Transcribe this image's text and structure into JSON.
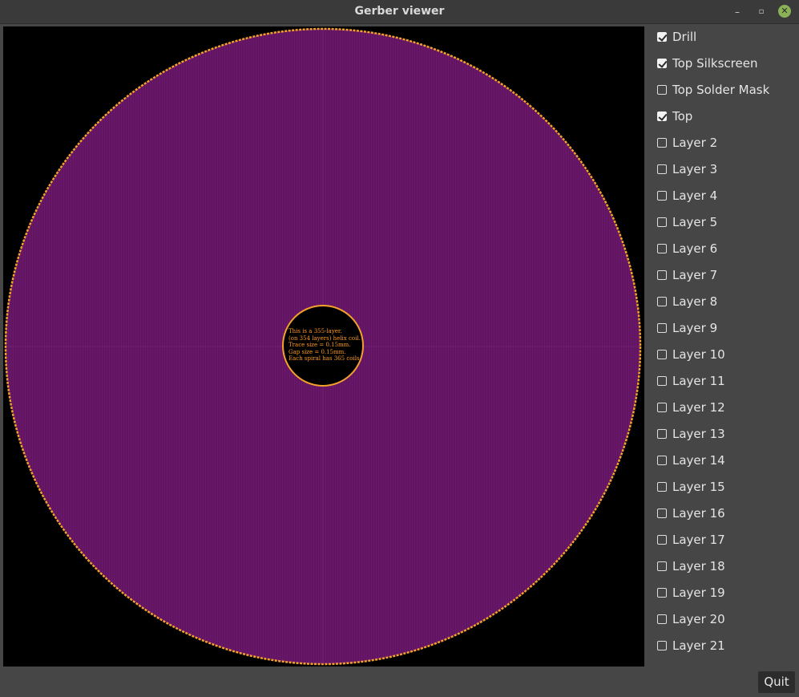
{
  "window": {
    "title": "Gerber viewer",
    "controls": {
      "minimize": "–",
      "maximize": "▫",
      "close": "✕"
    }
  },
  "board": {
    "text_lines": [
      "This is a 355-layer.",
      "(on 354 layers) helix coil.",
      "Trace size = 0.15mm.",
      "Gap size = 0.15mm.",
      "Each spiral has 365 coils."
    ],
    "colors": {
      "board_fill": "#621463",
      "outline": "#f4a12a",
      "silkscreen_text": "#ff9a1f",
      "background": "#000000"
    }
  },
  "layers": [
    {
      "label": "Drill",
      "checked": true
    },
    {
      "label": "Top Silkscreen",
      "checked": true
    },
    {
      "label": "Top Solder Mask",
      "checked": false
    },
    {
      "label": "Top",
      "checked": true
    },
    {
      "label": "Layer 2",
      "checked": false
    },
    {
      "label": "Layer 3",
      "checked": false
    },
    {
      "label": "Layer 4",
      "checked": false
    },
    {
      "label": "Layer 5",
      "checked": false
    },
    {
      "label": "Layer 6",
      "checked": false
    },
    {
      "label": "Layer 7",
      "checked": false
    },
    {
      "label": "Layer 8",
      "checked": false
    },
    {
      "label": "Layer 9",
      "checked": false
    },
    {
      "label": "Layer 10",
      "checked": false
    },
    {
      "label": "Layer 11",
      "checked": false
    },
    {
      "label": "Layer 12",
      "checked": false
    },
    {
      "label": "Layer 13",
      "checked": false
    },
    {
      "label": "Layer 14",
      "checked": false
    },
    {
      "label": "Layer 15",
      "checked": false
    },
    {
      "label": "Layer 16",
      "checked": false
    },
    {
      "label": "Layer 17",
      "checked": false
    },
    {
      "label": "Layer 18",
      "checked": false
    },
    {
      "label": "Layer 19",
      "checked": false
    },
    {
      "label": "Layer 20",
      "checked": false
    },
    {
      "label": "Layer 21",
      "checked": false
    },
    {
      "label": "",
      "checked": false
    }
  ],
  "buttons": {
    "quit": "Quit"
  }
}
